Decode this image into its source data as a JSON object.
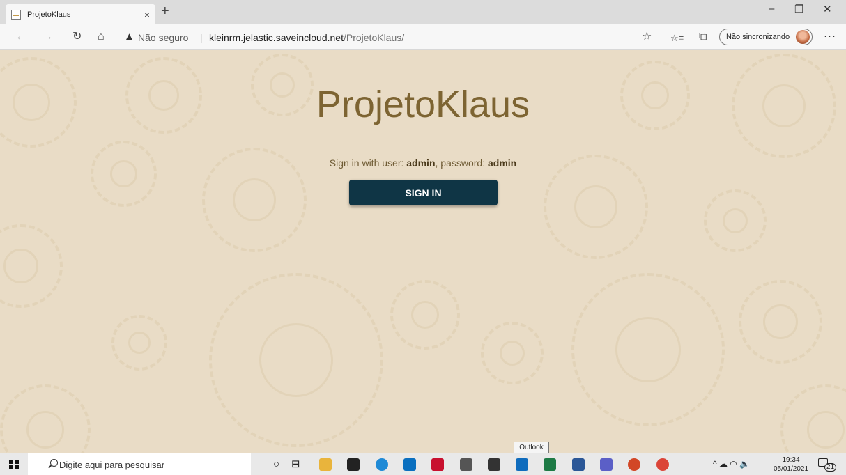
{
  "browser": {
    "tab_title": "ProjetoKlaus",
    "tab_close": "×",
    "new_tab": "+",
    "window_controls": [
      "–",
      "❐",
      "✕"
    ],
    "back": "←",
    "forward": "→",
    "refresh": "↻",
    "home": "⌂",
    "warning_glyph": "▲",
    "security_label": "Não seguro",
    "separator": "|",
    "url_host": "kleinrm.jelastic.saveincloud.net",
    "url_path": "/ProjetoKlaus/",
    "favorite_glyph": "☆",
    "favorites_glyph": "☆≡",
    "collections_glyph": "⧉",
    "sync_label": "Não sincronizando",
    "more_glyph": "···"
  },
  "page": {
    "title": "ProjetoKlaus",
    "hint_prefix": "Sign in with user: ",
    "hint_user": "admin",
    "hint_mid": ", password: ",
    "hint_password": "admin",
    "signin_label": "SIGN IN"
  },
  "tooltip": "Outlook",
  "taskbar": {
    "search_placeholder": "Digite aqui para pesquisar",
    "cortana_glyph": "○",
    "taskview_glyph": "⊟",
    "tray_glyphs": "^ ☁ ◠ 🔈",
    "time": "19:34",
    "date": "05/01/2021",
    "notifications": "21",
    "icons": [
      {
        "name": "file-explorer-icon",
        "color": "#e9b43c"
      },
      {
        "name": "store-icon",
        "color": "#222222"
      },
      {
        "name": "edge-icon",
        "color": "#1f8ad6"
      },
      {
        "name": "mail-icon",
        "color": "#0a6fbf"
      },
      {
        "name": "mcafee-icon",
        "color": "#c8102e"
      },
      {
        "name": "settings-icon",
        "color": "#555555"
      },
      {
        "name": "feedback-icon",
        "color": "#333333"
      },
      {
        "name": "outlook-icon",
        "color": "#0f6cbd"
      },
      {
        "name": "excel-icon",
        "color": "#1d7a45"
      },
      {
        "name": "word-icon",
        "color": "#2b5797"
      },
      {
        "name": "teams-icon",
        "color": "#5b5fc7"
      },
      {
        "name": "powerpoint-icon",
        "color": "#d24726"
      },
      {
        "name": "chrome-icon",
        "color": "#db4437"
      }
    ]
  },
  "colors": {
    "page_bg": "#e9dcc6",
    "heading": "#7d6432",
    "button_bg": "#0f3545"
  }
}
